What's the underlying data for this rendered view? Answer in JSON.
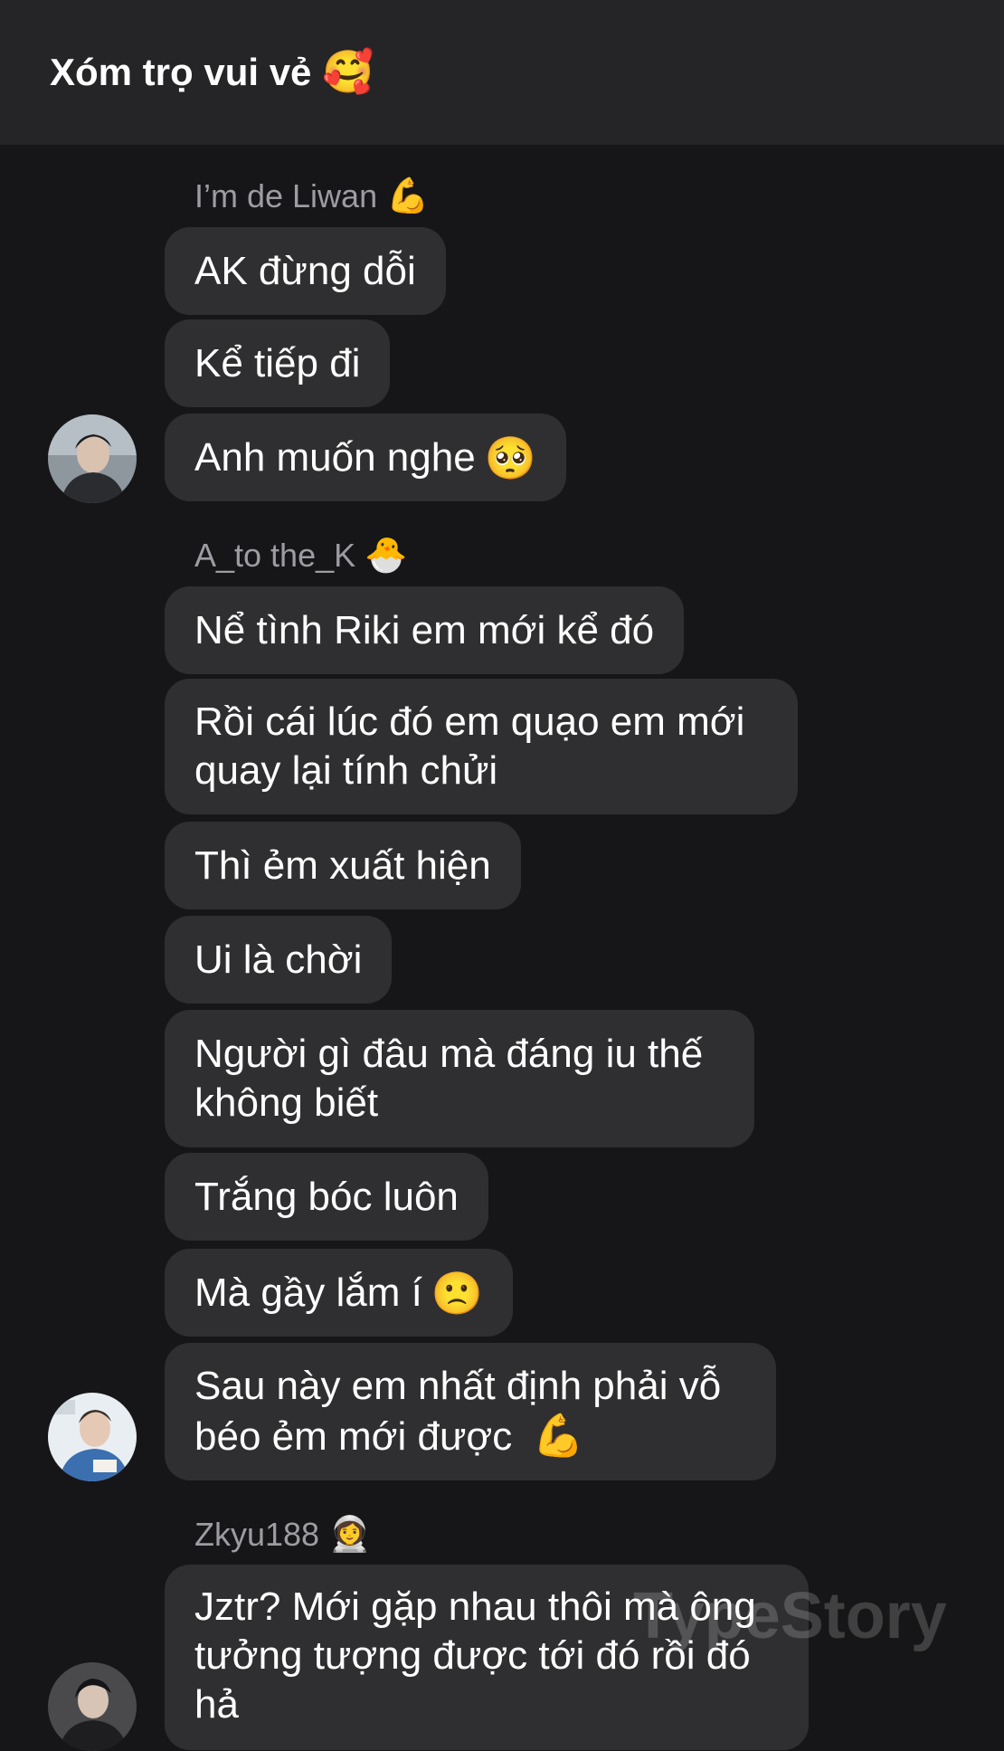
{
  "header": {
    "title": "Xóm trọ vui vẻ",
    "title_emoji": "🥰"
  },
  "groups": [
    {
      "sender": {
        "name": "I’m de Liwan",
        "emoji": "💪"
      },
      "messages": [
        {
          "text": "AK đừng dỗi"
        },
        {
          "text": "Kể tiếp đi"
        },
        {
          "text": "Anh muốn nghe",
          "emoji": "🥺"
        }
      ],
      "avatar": "avatar-liwan"
    },
    {
      "sender": {
        "name": "A_to the_K",
        "emoji": "🐣"
      },
      "messages": [
        {
          "text": "Nể tình Riki em mới kể đó"
        },
        {
          "line1": "Rồi cái lúc đó em quạo em mới",
          "line2": "quay lại tính chửi"
        },
        {
          "text": "Thì ẻm xuất hiện"
        },
        {
          "text": "Ui là chời"
        },
        {
          "line1": "Người gì đâu mà đáng iu thế",
          "line2": "không biết"
        },
        {
          "text": "Trắng bóc luôn"
        },
        {
          "text": "Mà gầy lắm í",
          "emoji": "🙁"
        },
        {
          "line1": "Sau này em nhất định phải vỗ",
          "line2": "béo ẻm mới được",
          "emoji": "💪"
        }
      ],
      "avatar": "avatar-atothek"
    },
    {
      "sender": {
        "name": "Zkyu188",
        "emoji": "👩‍🚀"
      },
      "messages": [
        {
          "line1": "Jztr? Mới gặp nhau thôi mà ông",
          "line2": "tưởng tượng được tới đó rồi đó",
          "line3": "hả"
        }
      ],
      "avatar": "avatar-zkyu"
    }
  ],
  "watermark": "TypeStory",
  "colors": {
    "background": "#161618",
    "header": "#252527",
    "bubble": "#2f2f31",
    "sender_text": "#9c9ca2",
    "text": "#ffffff"
  }
}
